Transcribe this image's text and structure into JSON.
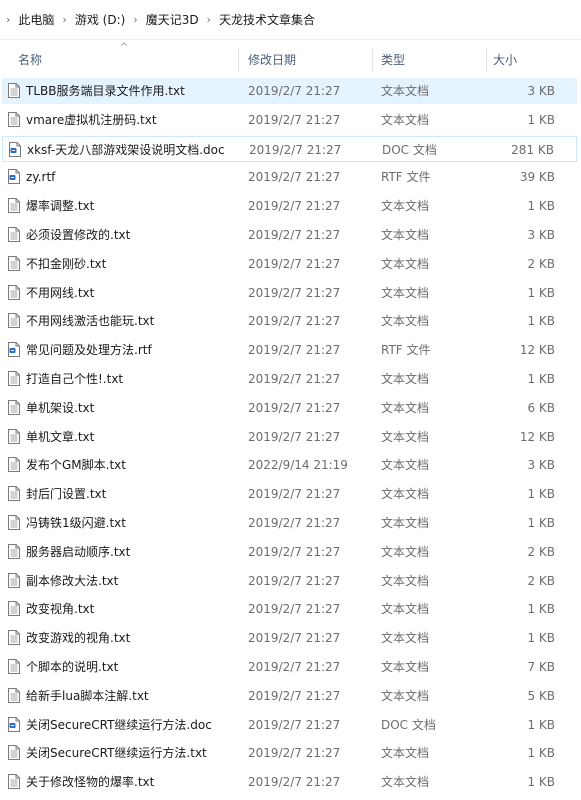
{
  "breadcrumb": [
    "此电脑",
    "游戏 (D:)",
    "魔天记3D",
    "天龙技术文章集合"
  ],
  "columns": {
    "name": "名称",
    "date": "修改日期",
    "type": "类型",
    "size": "大小"
  },
  "files": [
    {
      "name": "TLBB服务端目录文件作用.txt",
      "date": "2019/2/7 21:27",
      "type": "文本文档",
      "size": "3 KB",
      "icon": "text-file-icon"
    },
    {
      "name": "vmare虚拟机注册码.txt",
      "date": "2019/2/7 21:27",
      "type": "文本文档",
      "size": "1 KB",
      "icon": "text-file-icon"
    },
    {
      "name": "xksf-天龙八部游戏架设说明文档.doc",
      "date": "2019/2/7 21:27",
      "type": "DOC 文档",
      "size": "281 KB",
      "icon": "doc-file-icon"
    },
    {
      "name": "zy.rtf",
      "date": "2019/2/7 21:27",
      "type": "RTF 文件",
      "size": "39 KB",
      "icon": "doc-file-icon"
    },
    {
      "name": "爆率调整.txt",
      "date": "2019/2/7 21:27",
      "type": "文本文档",
      "size": "1 KB",
      "icon": "text-file-icon"
    },
    {
      "name": "必须设置修改的.txt",
      "date": "2019/2/7 21:27",
      "type": "文本文档",
      "size": "3 KB",
      "icon": "text-file-icon"
    },
    {
      "name": "不扣金刚砂.txt",
      "date": "2019/2/7 21:27",
      "type": "文本文档",
      "size": "2 KB",
      "icon": "text-file-icon"
    },
    {
      "name": "不用网线.txt",
      "date": "2019/2/7 21:27",
      "type": "文本文档",
      "size": "1 KB",
      "icon": "text-file-icon"
    },
    {
      "name": "不用网线激活也能玩.txt",
      "date": "2019/2/7 21:27",
      "type": "文本文档",
      "size": "1 KB",
      "icon": "text-file-icon"
    },
    {
      "name": "常见问题及处理方法.rtf",
      "date": "2019/2/7 21:27",
      "type": "RTF 文件",
      "size": "12 KB",
      "icon": "doc-file-icon"
    },
    {
      "name": "打造自己个性!.txt",
      "date": "2019/2/7 21:27",
      "type": "文本文档",
      "size": "1 KB",
      "icon": "text-file-icon"
    },
    {
      "name": "单机架设.txt",
      "date": "2019/2/7 21:27",
      "type": "文本文档",
      "size": "6 KB",
      "icon": "text-file-icon"
    },
    {
      "name": "单机文章.txt",
      "date": "2019/2/7 21:27",
      "type": "文本文档",
      "size": "12 KB",
      "icon": "text-file-icon"
    },
    {
      "name": "发布个GM脚本.txt",
      "date": "2022/9/14 21:19",
      "type": "文本文档",
      "size": "3 KB",
      "icon": "text-file-icon"
    },
    {
      "name": "封后门设置.txt",
      "date": "2019/2/7 21:27",
      "type": "文本文档",
      "size": "1 KB",
      "icon": "text-file-icon"
    },
    {
      "name": "冯铸铁1级闪避.txt",
      "date": "2019/2/7 21:27",
      "type": "文本文档",
      "size": "1 KB",
      "icon": "text-file-icon"
    },
    {
      "name": "服务器启动顺序.txt",
      "date": "2019/2/7 21:27",
      "type": "文本文档",
      "size": "2 KB",
      "icon": "text-file-icon"
    },
    {
      "name": "副本修改大法.txt",
      "date": "2019/2/7 21:27",
      "type": "文本文档",
      "size": "2 KB",
      "icon": "text-file-icon"
    },
    {
      "name": "改变视角.txt",
      "date": "2019/2/7 21:27",
      "type": "文本文档",
      "size": "1 KB",
      "icon": "text-file-icon"
    },
    {
      "name": "改变游戏的视角.txt",
      "date": "2019/2/7 21:27",
      "type": "文本文档",
      "size": "1 KB",
      "icon": "text-file-icon"
    },
    {
      "name": "个脚本的说明.txt",
      "date": "2019/2/7 21:27",
      "type": "文本文档",
      "size": "7 KB",
      "icon": "text-file-icon"
    },
    {
      "name": "给新手lua脚本注解.txt",
      "date": "2019/2/7 21:27",
      "type": "文本文档",
      "size": "5 KB",
      "icon": "text-file-icon"
    },
    {
      "name": "关闭SecureCRT继续运行方法.doc",
      "date": "2019/2/7 21:27",
      "type": "DOC 文档",
      "size": "1 KB",
      "icon": "doc-file-icon"
    },
    {
      "name": "关闭SecureCRT继续运行方法.txt",
      "date": "2019/2/7 21:27",
      "type": "文本文档",
      "size": "1 KB",
      "icon": "text-file-icon"
    },
    {
      "name": "关于修改怪物的爆率.txt",
      "date": "2019/2/7 21:27",
      "type": "文本文档",
      "size": "1 KB",
      "icon": "text-file-icon"
    }
  ],
  "selected_index": 0,
  "hover_index": 2,
  "colors": {
    "selected_bg": "#e5f3ff",
    "hover_border": "#cce8ff",
    "header_text": "#4c607a",
    "doc_icon": "#2b6cc4"
  }
}
